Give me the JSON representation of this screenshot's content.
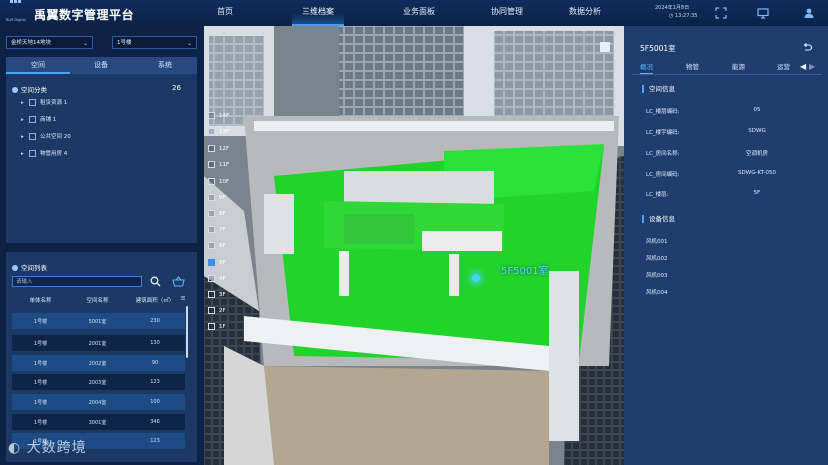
{
  "colors": {
    "accent": "#3da0ff",
    "green_highlight": "#22d42a",
    "panel": "#1c3966",
    "topbar": "#0f2d5c"
  },
  "header": {
    "logo_sub": "BLM Digital",
    "title": "禹翼数字管理平台",
    "nav": [
      "首页",
      "三维档案",
      "业务面板",
      "协同管理",
      "数据分析"
    ],
    "nav_active": "三维档案",
    "date": "2024年1月8日",
    "time": "13:27:35",
    "icons": [
      "fullscreen-icon",
      "monitor-icon",
      "user-icon"
    ]
  },
  "left": {
    "site_select": "金桥天地14地块",
    "building_select": "1号楼",
    "tabs": [
      "空间",
      "设备",
      "系统"
    ],
    "active_tab": "空间",
    "tree_root": "空间分类",
    "tree_count": "26",
    "tree_items": [
      "租赁资源 1",
      "商铺 1",
      "公共空间 20",
      "物管用房 4"
    ],
    "list_title": "空间列表",
    "search_placeholder": "请输入",
    "columns": [
      "单体名称",
      "空间名称",
      "建筑面积（㎡）"
    ],
    "rows": [
      [
        "1号楼",
        "5001室",
        "230"
      ],
      [
        "1号楼",
        "2001室",
        "130"
      ],
      [
        "1号楼",
        "2002室",
        "90"
      ],
      [
        "1号楼",
        "2003室",
        "123"
      ],
      [
        "1号楼",
        "2004室",
        "100"
      ],
      [
        "1号楼",
        "3001室",
        "346"
      ],
      [
        "1号楼",
        "",
        "123"
      ]
    ]
  },
  "scene": {
    "floors": [
      "14F",
      "13F",
      "12F",
      "11F",
      "10F",
      "9F",
      "8F",
      "7F",
      "6F",
      "5F",
      "4F",
      "3F",
      "2F",
      "1F"
    ],
    "checked_floor": "5F",
    "room_label": "5F5001室"
  },
  "right": {
    "title": "5F5001室",
    "tabs": [
      "概况",
      "物管",
      "能源",
      "运营"
    ],
    "active_tab": "概况",
    "space_info_title": "空间信息",
    "space_info": [
      {
        "k": "LC_楼层编码:",
        "v": "05"
      },
      {
        "k": "LC_楼宇编码:",
        "v": "SDWG"
      },
      {
        "k": "LC_房间名称:",
        "v": "空调机房"
      },
      {
        "k": "LC_房间编码:",
        "v": "SDWG-KT-050"
      },
      {
        "k": "LC_楼层:",
        "v": "5F"
      }
    ],
    "device_title": "设备信息",
    "devices": [
      "风机001",
      "风机002",
      "风机003",
      "风机004"
    ]
  },
  "watermark": "大数跨境"
}
